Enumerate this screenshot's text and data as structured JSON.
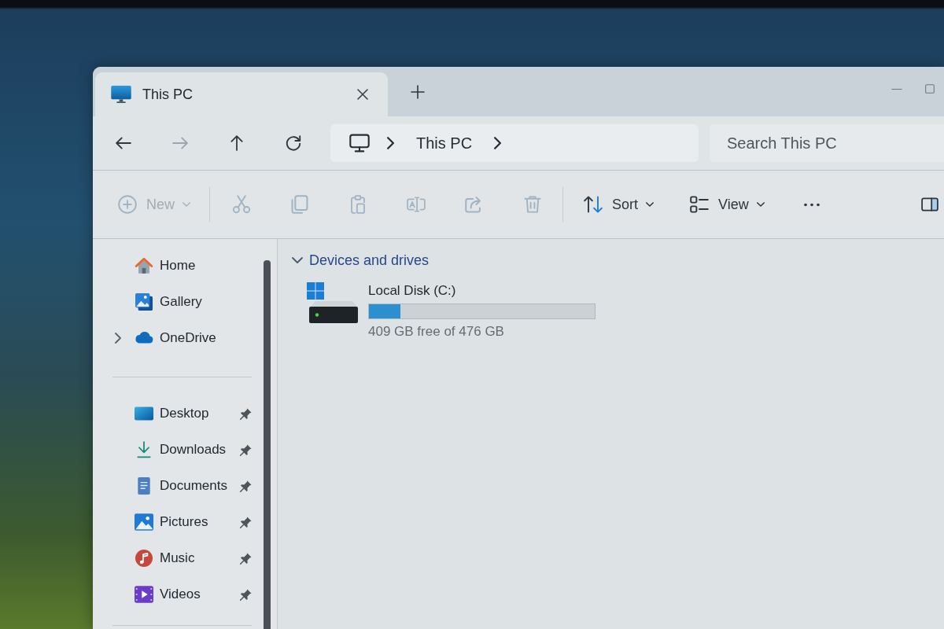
{
  "tabs": [
    {
      "title": "This PC",
      "selected": true
    }
  ],
  "navigation": {
    "buttons": [
      {
        "kind": "back",
        "disabled": false
      },
      {
        "kind": "forward",
        "disabled": true
      },
      {
        "kind": "up",
        "disabled": false
      },
      {
        "kind": "refresh",
        "disabled": false
      }
    ]
  },
  "address_bar": {
    "segments": [
      "This PC"
    ]
  },
  "search": {
    "placeholder": "Search This PC"
  },
  "command_bar": {
    "groups": [
      {
        "items": [
          {
            "kind": "new",
            "label": "New",
            "disabled": true
          }
        ]
      },
      {
        "items": [
          {
            "kind": "cut",
            "disabled": true
          },
          {
            "kind": "copy",
            "disabled": true
          },
          {
            "kind": "paste",
            "disabled": true
          },
          {
            "kind": "rename",
            "disabled": true
          },
          {
            "kind": "share",
            "disabled": true
          },
          {
            "kind": "delete",
            "disabled": true
          }
        ]
      },
      {
        "items": [
          {
            "kind": "sort",
            "label": "Sort",
            "disabled": false
          },
          {
            "kind": "view",
            "label": "View",
            "disabled": false
          },
          {
            "kind": "more",
            "disabled": false
          }
        ]
      }
    ],
    "end_items": [
      {
        "kind": "details",
        "disabled": false
      }
    ]
  },
  "sidebar": {
    "groups": [
      {
        "items": [
          {
            "kind": "home",
            "label": "Home",
            "expandable": false,
            "pinned": false,
            "selected": false
          },
          {
            "kind": "gallery",
            "label": "Gallery",
            "expandable": false,
            "pinned": false,
            "selected": false
          },
          {
            "kind": "cloud",
            "label": "OneDrive",
            "expandable": true,
            "pinned": false,
            "selected": false
          }
        ]
      },
      {
        "items": [
          {
            "kind": "desktop",
            "label": "Desktop",
            "expandable": false,
            "pinned": true,
            "selected": false
          },
          {
            "kind": "downloads",
            "label": "Downloads",
            "expandable": false,
            "pinned": true,
            "selected": false
          },
          {
            "kind": "documents",
            "label": "Documents",
            "expandable": false,
            "pinned": true,
            "selected": false
          },
          {
            "kind": "pictures",
            "label": "Pictures",
            "expandable": false,
            "pinned": true,
            "selected": false
          },
          {
            "kind": "music",
            "label": "Music",
            "expandable": false,
            "pinned": true,
            "selected": false
          },
          {
            "kind": "videos",
            "label": "Videos",
            "expandable": false,
            "pinned": true,
            "selected": false
          }
        ]
      }
    ]
  },
  "sections": [
    {
      "title": "Devices and drives",
      "expanded": true,
      "drives": [
        {
          "name": "Local Disk (C:)",
          "level": 0.14,
          "space": "409 GB free of 476 GB"
        }
      ]
    }
  ]
}
